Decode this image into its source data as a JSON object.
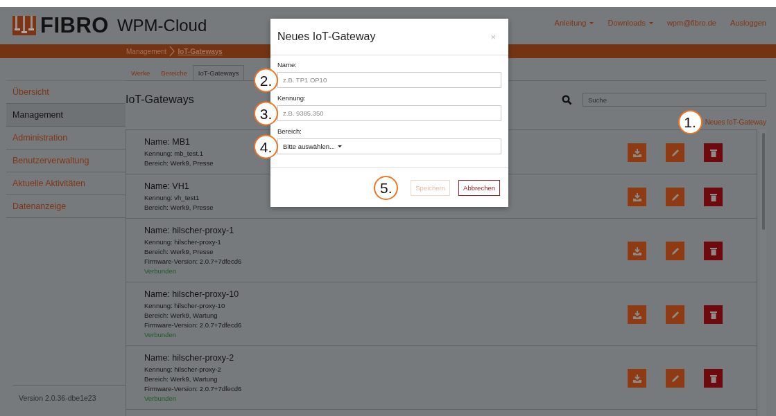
{
  "header": {
    "logo": "FIBRO",
    "app_title": "WPM-Cloud",
    "nav": [
      {
        "label": "Anleitung",
        "dropdown": true
      },
      {
        "label": "Downloads",
        "dropdown": true
      },
      {
        "label": "wpm@fibro.de",
        "dropdown": false
      },
      {
        "label": "Ausloggen",
        "dropdown": false
      }
    ]
  },
  "breadcrumb": [
    {
      "label": "Management",
      "current": false
    },
    {
      "label": "IoT-Gateways",
      "current": true
    }
  ],
  "sidebar": {
    "items": [
      {
        "label": "Übersicht",
        "selected": false
      },
      {
        "label": "Management",
        "selected": true
      },
      {
        "label": "Administration",
        "selected": false
      },
      {
        "label": "Benutzerverwaltung",
        "selected": false
      },
      {
        "label": "Aktuelle Aktivitäten",
        "selected": false
      },
      {
        "label": "Datenanzeige",
        "selected": false
      }
    ],
    "version": "Version 2.0.36-dbe1e23"
  },
  "tabs": [
    {
      "label": "Werke",
      "selected": false
    },
    {
      "label": "Bereiche",
      "selected": false
    },
    {
      "label": "IoT-Gateways",
      "selected": true
    }
  ],
  "page_title": "IoT-Gateways",
  "search": {
    "placeholder": "Suche"
  },
  "new_link": {
    "label": "Neues IoT-Gateway",
    "callout": "1."
  },
  "gateways": [
    {
      "name": "Name: MB1",
      "lines": [
        "Kennung: mb_test.1",
        "Bereich: Werk9, Presse"
      ]
    },
    {
      "name": "Name: VH1",
      "lines": [
        "Kennung: vh_test1",
        "Bereich: Werk9, Presse"
      ]
    },
    {
      "name": "Name: hilscher-proxy-1",
      "lines": [
        "Kennung: hilscher-proxy-1",
        "Bereich: Werk9, Presse",
        "Firmware-Version: 2.0.7+7dfecd6"
      ],
      "status": "Verbunden"
    },
    {
      "name": "Name: hilscher-proxy-10",
      "lines": [
        "Kennung: hilscher-proxy-10",
        "Bereich: Werk9, Wartung",
        "Firmware-Version: 2.0.7+7dfecd6"
      ],
      "status": "Verbunden"
    },
    {
      "name": "Name: hilscher-proxy-2",
      "lines": [
        "Kennung: hilscher-proxy-2",
        "Bereich: Werk9, Wartung",
        "Firmware-Version: 2.0.7+7dfecd6"
      ],
      "status": "Verbunden"
    }
  ],
  "modal": {
    "title": "Neues IoT-Gateway",
    "close": "×",
    "fields": [
      {
        "label": "Name:",
        "kind": "text",
        "placeholder": "z.B. TP1 OP10",
        "callout": "2."
      },
      {
        "label": "Kennung:",
        "kind": "text",
        "placeholder": "z.B. 9385.350",
        "callout": "3."
      },
      {
        "label": "Bereich:",
        "kind": "select",
        "value": "Bitte auswählen...",
        "callout": "4."
      }
    ],
    "footer_callout": "5.",
    "buttons": [
      {
        "label": "Speichern",
        "kind": "save",
        "disabled": true
      },
      {
        "label": "Abbrechen",
        "kind": "cancel",
        "disabled": false
      }
    ]
  }
}
